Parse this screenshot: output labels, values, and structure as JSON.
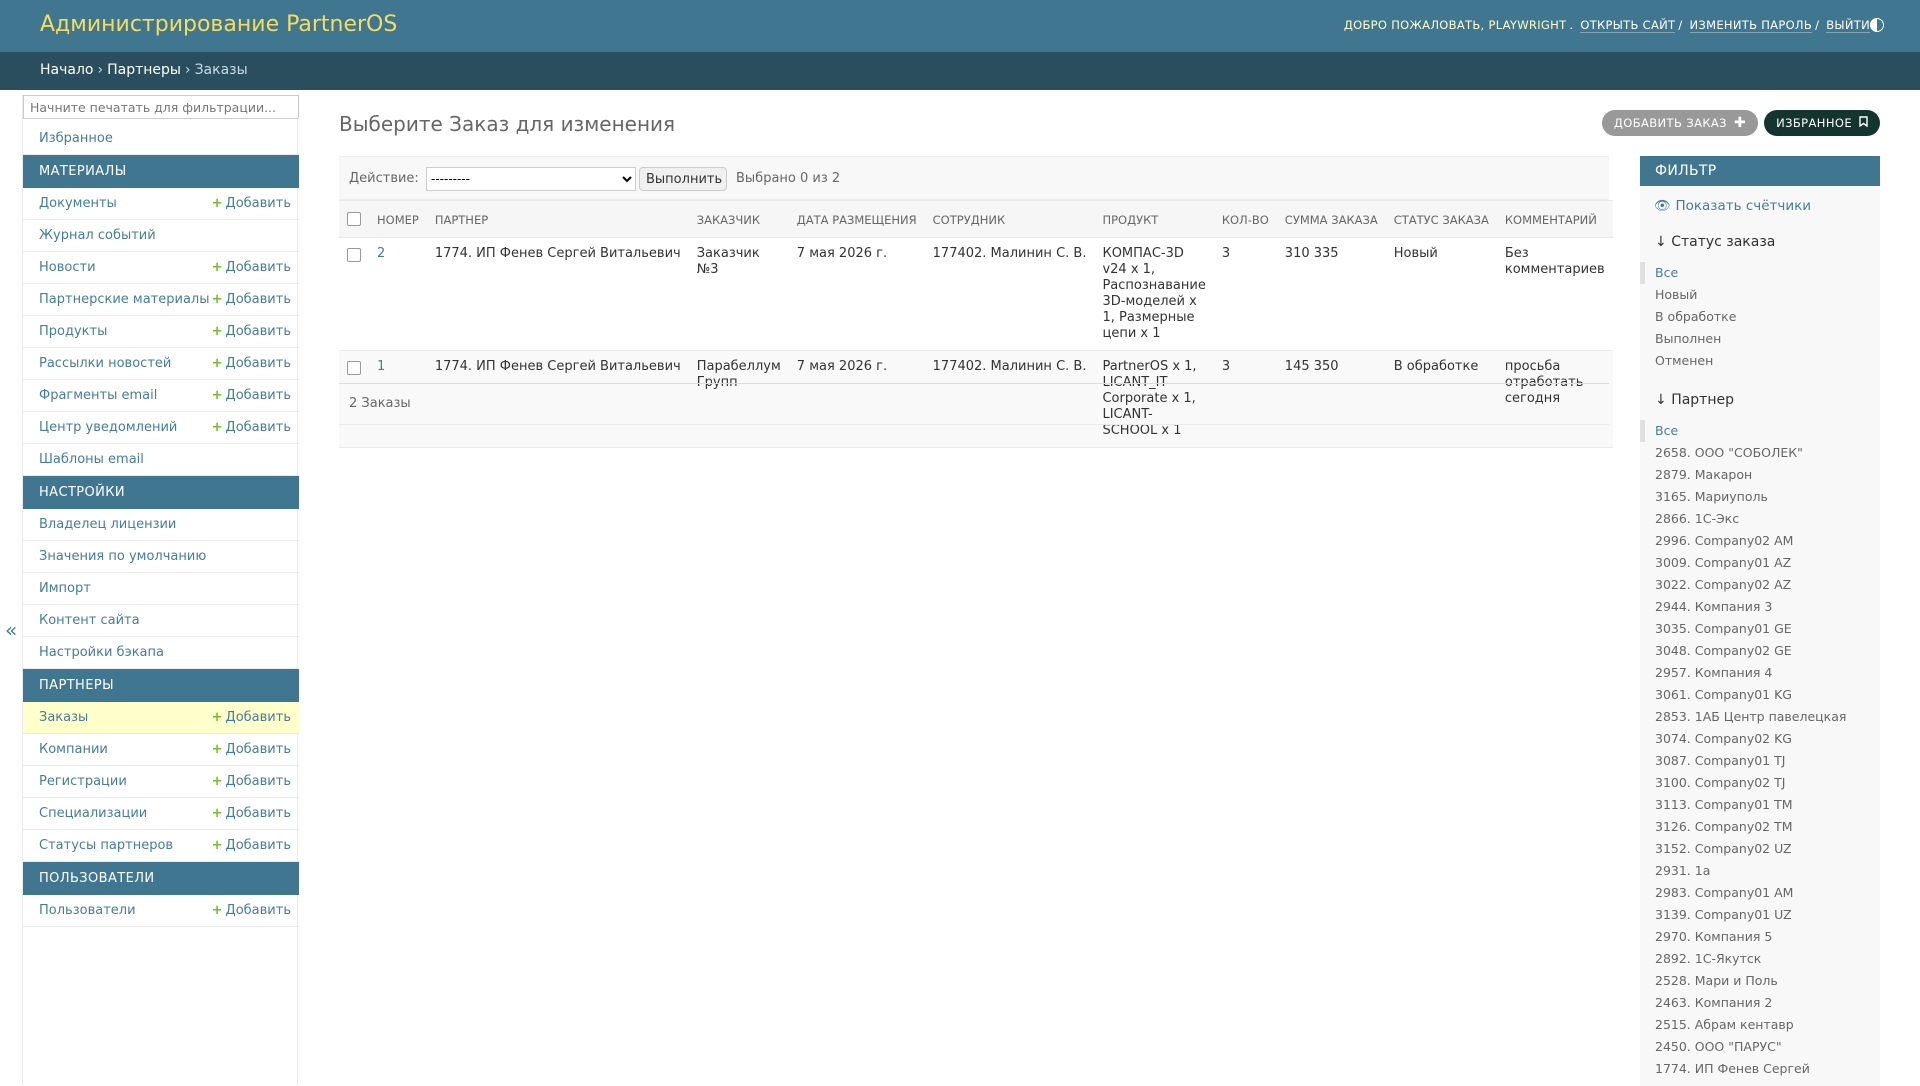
{
  "header": {
    "title": "Администрирование PartnerOS",
    "welcome": "Добро пожаловать,",
    "username": "playwright",
    "view_site": "Открыть сайт",
    "change_password": "Изменить пароль",
    "logout": "Выйти"
  },
  "breadcrumbs": [
    "Начало",
    "Партнеры",
    "Заказы"
  ],
  "sidebar": {
    "filter_placeholder": "Начните печатать для фильтрации...",
    "add_label": "Добавить",
    "favorites": "Избранное",
    "sections": [
      {
        "caption": "Материалы",
        "items": [
          {
            "label": "Документы",
            "add": true
          },
          {
            "label": "Журнал событий",
            "add": false
          },
          {
            "label": "Новости",
            "add": true
          },
          {
            "label": "Партнерские материалы",
            "add": true
          },
          {
            "label": "Продукты",
            "add": true
          },
          {
            "label": "Рассылки новостей",
            "add": true
          },
          {
            "label": "Фрагменты email",
            "add": true
          },
          {
            "label": "Центр уведомлений",
            "add": true
          },
          {
            "label": "Шаблоны email",
            "add": false
          }
        ]
      },
      {
        "caption": "Настройки",
        "items": [
          {
            "label": "Владелец лицензии",
            "add": false
          },
          {
            "label": "Значения по умолчанию",
            "add": false
          },
          {
            "label": "Импорт",
            "add": false
          },
          {
            "label": "Контент сайта",
            "add": false
          },
          {
            "label": "Настройки бэкапа",
            "add": false
          }
        ]
      },
      {
        "caption": "Партнеры",
        "items": [
          {
            "label": "Заказы",
            "add": true,
            "current": true
          },
          {
            "label": "Компании",
            "add": true
          },
          {
            "label": "Регистрации",
            "add": true
          },
          {
            "label": "Специализации",
            "add": true
          },
          {
            "label": "Статусы партнеров",
            "add": true
          }
        ]
      },
      {
        "caption": "Пользователи",
        "items": [
          {
            "label": "Пользователи",
            "add": true
          }
        ]
      }
    ]
  },
  "content": {
    "title": "Выберите Заказ для изменения",
    "add_button": "Добавить Заказ",
    "favorites_button": "Избранное",
    "action_label": "Действие:",
    "action_select": "---------",
    "go_button": "Выполнить",
    "selected_counter": "Выбрано 0 из 2",
    "columns": [
      "Номер",
      "Партнер",
      "Заказчик",
      "Дата размещения",
      "Сотрудник",
      "Продукт",
      "Кол-во",
      "Сумма заказа",
      "Статус заказа",
      "Комментарий"
    ],
    "rows": [
      {
        "number": "2",
        "partner": "1774. ИП Фенев Сергей Витальевич",
        "customer": "Заказчик №3",
        "date": "7 мая 2026 г.",
        "employee": "177402. Малинин С. В.",
        "product": "КОМПАС-3D v24 x 1, Распознавание 3D-моделей x 1, Размерные цепи x 1",
        "qty": "3",
        "sum": "310 335",
        "status": "Новый",
        "comment": "Без комментариев"
      },
      {
        "number": "1",
        "partner": "1774. ИП Фенев Сергей Витальевич",
        "customer": "Парабеллум Групп",
        "date": "7 мая 2026 г.",
        "employee": "177402. Малинин С. В.",
        "product": "PartnerOS x 1, LICANT_IT Corporate x 1, LICANT-SCHOOL x 1",
        "qty": "3",
        "sum": "145 350",
        "status": "В обработке",
        "comment": "просьба отработать сегодня"
      }
    ],
    "paginator": "2 Заказы"
  },
  "filter": {
    "title": "Фильтр",
    "show_counts": "Показать счётчики",
    "status": {
      "title": "Статус заказа",
      "options": [
        "Все",
        "Новый",
        "В обработке",
        "Выполнен",
        "Отменен"
      ],
      "selected": "Все"
    },
    "partner": {
      "title": "Партнер",
      "options": [
        "Все",
        "2658. ООО \"СОБОЛЕК\"",
        "2879. Макарон",
        "3165. Мариуполь",
        "2866. 1С-Экс",
        "2996. Company02 AM",
        "3009. Company01 AZ",
        "3022. Company02 AZ",
        "2944. Компания 3",
        "3035. Company01 GE",
        "3048. Company02 GE",
        "2957. Компания 4",
        "3061. Company01 KG",
        "2853. 1АБ Центр павелецкая",
        "3074. Company02 KG",
        "3087. Company01 TJ",
        "3100. Company02 TJ",
        "3113. Company01 TM",
        "3126. Company02 TM",
        "3152. Company02 UZ",
        "2931. 1а",
        "2983. Company01 AM",
        "3139. Company01 UZ",
        "2970. Компания 5",
        "2892. 1С-Якутск",
        "2528. Мари и Поль",
        "2463. Компания 2",
        "2515. Абрам кентавр",
        "2450. ООО \"ПАРУС\"",
        "1774. ИП Фенев Сергей"
      ],
      "selected": "Все"
    }
  },
  "colors": {
    "header": "#417690",
    "breadcrumbs": "#2b4e5f",
    "brand": "#f5dd5d",
    "link": "#447e9b",
    "add_plus": "#70bf2b",
    "current_row": "#ffffcc"
  }
}
